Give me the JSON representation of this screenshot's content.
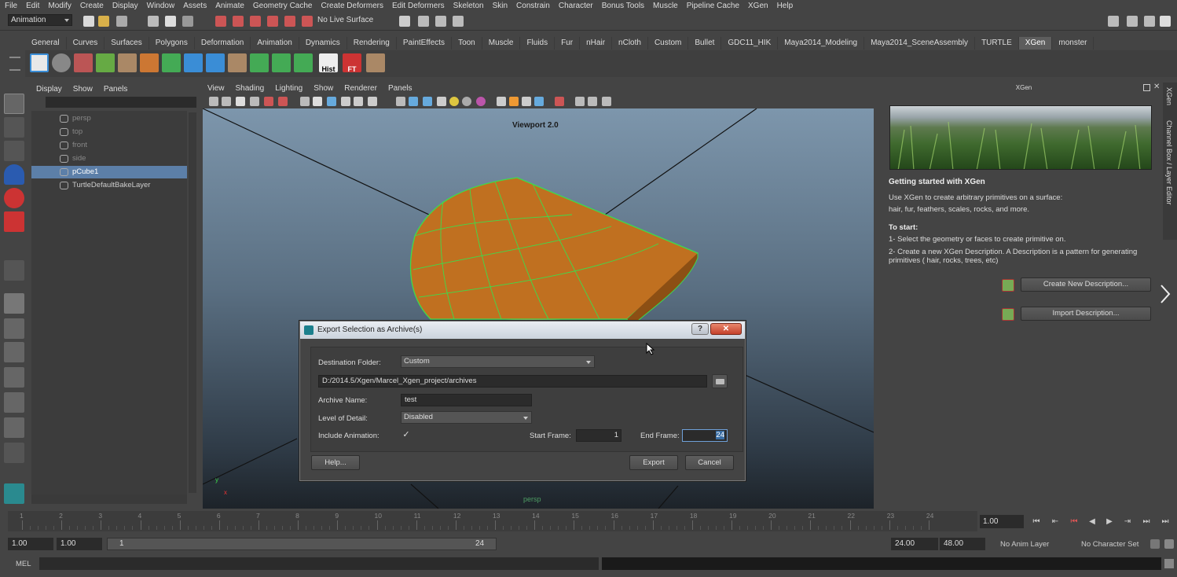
{
  "menubar": {
    "items": [
      "File",
      "Edit",
      "Modify",
      "Create",
      "Display",
      "Window",
      "Assets",
      "Animate",
      "Geometry Cache",
      "Create Deformers",
      "Edit Deformers",
      "Skeleton",
      "Skin",
      "Constrain",
      "Character",
      "Bonus Tools",
      "Muscle",
      "Pipeline Cache",
      "XGen",
      "Help"
    ]
  },
  "statusline": {
    "mode": "Animation",
    "live_surface": "No Live Surface"
  },
  "shelf": {
    "tabs": [
      "General",
      "Curves",
      "Surfaces",
      "Polygons",
      "Deformation",
      "Animation",
      "Dynamics",
      "Rendering",
      "PaintEffects",
      "Toon",
      "Muscle",
      "Fluids",
      "Fur",
      "nHair",
      "nCloth",
      "Custom",
      "Bullet",
      "GDC11_HIK",
      "Maya2014_Modeling",
      "Maya2014_SceneAssembly",
      "TURTLE",
      "XGen",
      "monster"
    ],
    "active_tab": "XGen",
    "icon_labels": {
      "hist": "Hist",
      "ft": "FT"
    }
  },
  "outliner": {
    "menu": [
      "Display",
      "Show",
      "Panels"
    ],
    "items": [
      {
        "label": "persp",
        "state": "dim"
      },
      {
        "label": "top",
        "state": "dim"
      },
      {
        "label": "front",
        "state": "dim"
      },
      {
        "label": "side",
        "state": "dim"
      },
      {
        "label": "pCube1",
        "state": "selected"
      },
      {
        "label": "TurtleDefaultBakeLayer",
        "state": "normal"
      }
    ]
  },
  "viewport": {
    "menu": [
      "View",
      "Shading",
      "Lighting",
      "Show",
      "Renderer",
      "Panels"
    ],
    "label": "Viewport 2.0",
    "camera": "persp",
    "axis": {
      "y": "y",
      "x": "x"
    }
  },
  "dialog": {
    "title": "Export Selection as Archive(s)",
    "help_glyph": "?",
    "close_glyph": "✕",
    "destination_label": "Destination Folder:",
    "destination_value": "Custom",
    "path": "D:/2014.5/Xgen/Marcel_Xgen_project/archives",
    "archive_name_label": "Archive Name:",
    "archive_name": "test",
    "lod_label": "Level of Detail:",
    "lod_value": "Disabled",
    "include_anim_label": "Include Animation:",
    "include_anim_check": "✓",
    "start_frame_label": "Start Frame:",
    "start_frame": "1",
    "end_frame_label": "End Frame:",
    "end_frame": "24",
    "help_button": "Help...",
    "export_button": "Export",
    "cancel_button": "Cancel"
  },
  "xgen": {
    "header": "XGen",
    "title": "Getting started with XGen",
    "intro1": "Use XGen to create arbitrary primitives on a surface:",
    "intro2": "hair, fur, feathers, scales, rocks, and more.",
    "to_start": "To start:",
    "step1": "1- Select the geometry or faces to create primitive on.",
    "step2a": "2- Create a new XGen Description. A Description is a pattern for generating",
    "step2b": "primitives ( hair, rocks, trees, etc)",
    "create_button": "Create New Description...",
    "import_button": "Import Description..."
  },
  "side_tabs": {
    "xgen": "XGen",
    "channel_box": "Channel Box / Layer Editor"
  },
  "timeslider": {
    "ticks": [
      "1",
      "2",
      "3",
      "4",
      "5",
      "6",
      "7",
      "8",
      "9",
      "10",
      "11",
      "12",
      "13",
      "14",
      "15",
      "16",
      "17",
      "18",
      "19",
      "20",
      "21",
      "22",
      "23",
      "24"
    ],
    "current_frame": "1.00"
  },
  "range": {
    "start_time": "1.00",
    "playback_start": "1.00",
    "slider_start": "1",
    "slider_end": "24",
    "playback_end": "24.00",
    "end_time": "48.00",
    "anim_layer": "No Anim Layer",
    "character_set": "No Character Set"
  },
  "commandline": {
    "label": "MEL"
  },
  "colors": {
    "accent": "#5c7fa8",
    "mesh": "#c9761c",
    "wire": "#3ddc4b"
  }
}
